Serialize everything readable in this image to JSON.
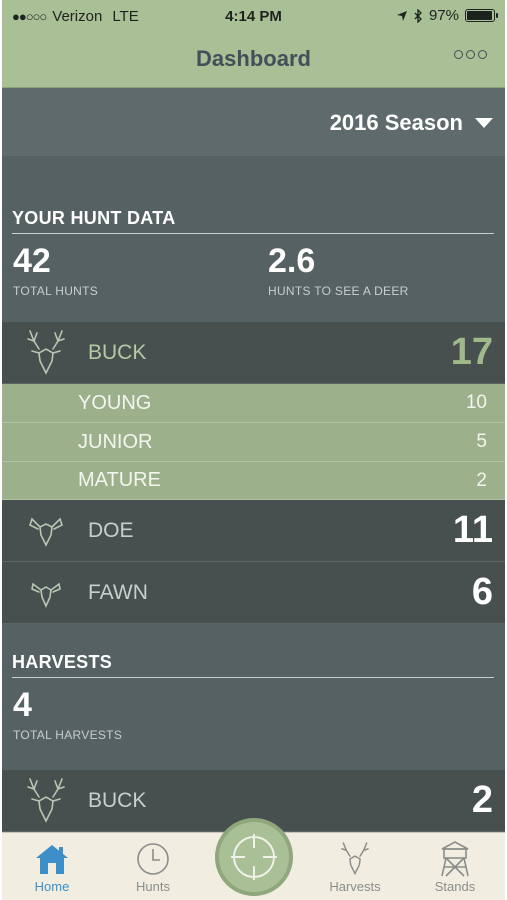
{
  "status": {
    "carrier": "Verizon",
    "network": "LTE",
    "time": "4:14 PM",
    "battery": "97%",
    "battery_level": 0.97
  },
  "nav": {
    "title": "Dashboard",
    "more_icon": "more-icon"
  },
  "season": {
    "label": "2016 Season"
  },
  "hunt_data": {
    "heading": "YOUR HUNT DATA",
    "total_hunts": {
      "value": "42",
      "label": "TOTAL HUNTS"
    },
    "hunts_to_see": {
      "value": "2.6",
      "label": "HUNTS TO SEE A DEER"
    },
    "buck": {
      "label": "BUCK",
      "count": "17",
      "icon": "buck-icon"
    },
    "buck_breakdown": [
      {
        "label": "YOUNG",
        "count": "10"
      },
      {
        "label": "JUNIOR",
        "count": "5"
      },
      {
        "label": "MATURE",
        "count": "2"
      }
    ],
    "doe": {
      "label": "DOE",
      "count": "11",
      "icon": "doe-icon"
    },
    "fawn": {
      "label": "FAWN",
      "count": "6",
      "icon": "fawn-icon"
    }
  },
  "harvests": {
    "heading": "HARVESTS",
    "total": {
      "value": "4",
      "label": "TOTAL HARVESTS"
    },
    "buck": {
      "label": "BUCK",
      "count": "2",
      "icon": "buck-icon"
    }
  },
  "tabs": [
    {
      "label": "Home",
      "icon": "home-icon",
      "active": true
    },
    {
      "label": "Hunts",
      "icon": "clock-icon"
    },
    {
      "label": "Harvests",
      "icon": "buck-icon"
    },
    {
      "label": "Stands",
      "icon": "tower-icon"
    }
  ],
  "center_action": {
    "icon": "crosshair-icon"
  },
  "colors": {
    "nav_green": "#a9bf96",
    "content_gray": "#566163",
    "row_dark": "#47504f",
    "sub_green": "#9cb08c",
    "active_tab": "#3c8fc8"
  }
}
